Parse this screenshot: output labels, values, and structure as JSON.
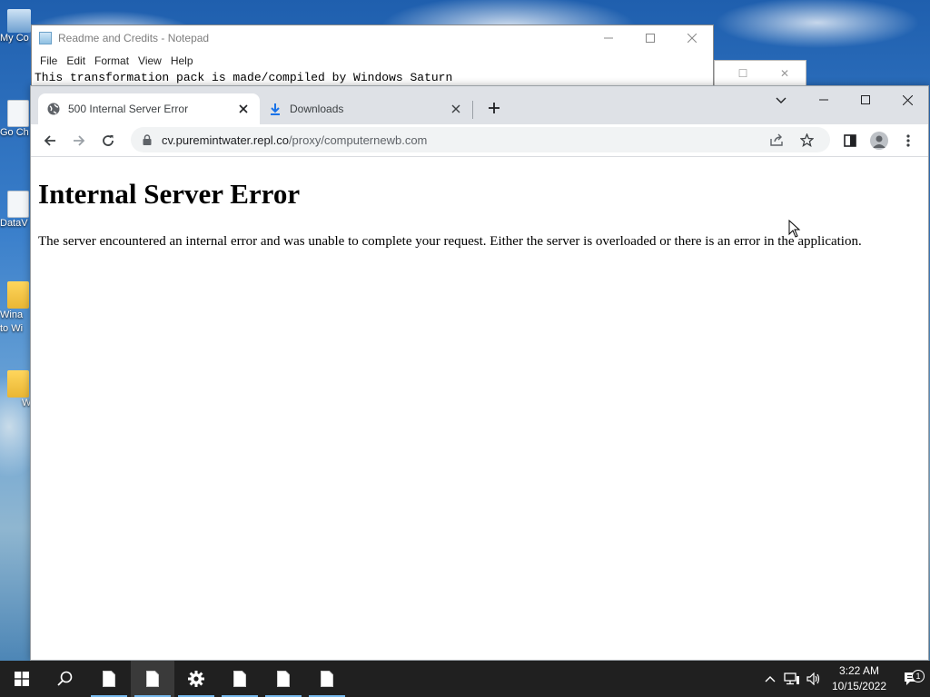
{
  "desktop": {
    "icons": [
      {
        "label": "My Co",
        "kind": "monitor"
      },
      {
        "label": "Go Ch",
        "kind": "shortcut"
      },
      {
        "label": "DataV",
        "kind": "shortcut"
      },
      {
        "label": "Wina to Wi",
        "kind": "folder"
      },
      {
        "label": "W",
        "kind": "folder"
      }
    ]
  },
  "notepad": {
    "title": "Readme and Credits - Notepad",
    "menu": [
      "File",
      "Edit",
      "Format",
      "View",
      "Help"
    ],
    "text": "This transformation pack is made/compiled by Windows Saturn"
  },
  "chrome": {
    "tabs": [
      {
        "label": "500 Internal Server Error",
        "icon": "globe-icon",
        "active": true
      },
      {
        "label": "Downloads",
        "icon": "download-icon",
        "active": false
      }
    ],
    "address": {
      "host": "cv.puremintwater.repl.co",
      "path": "/proxy/computernewb.com"
    }
  },
  "page": {
    "heading": "Internal Server Error",
    "message": "The server encountered an internal error and was unable to complete your request. Either the server is overloaded or there is an error in the application."
  },
  "taskbar": {
    "time": "3:22 AM",
    "date": "10/15/2022",
    "notification_count": "1",
    "accent": "#76b9ed"
  }
}
